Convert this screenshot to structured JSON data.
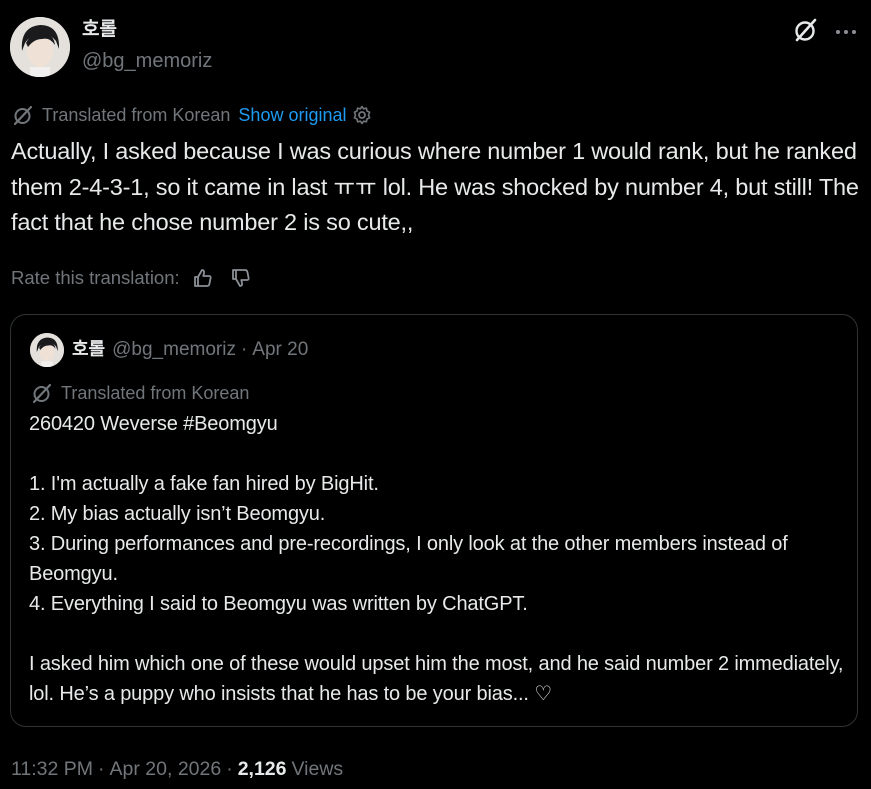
{
  "author": {
    "display_name": "호롤",
    "handle": "@bg_memoriz"
  },
  "header_actions": {
    "grok_icon": "grok-slash-icon",
    "more_icon": "more-dots-icon"
  },
  "translation": {
    "label": "Translated from Korean",
    "show_original": "Show original",
    "icon": "translate-slash-icon",
    "settings_icon": "gear-icon"
  },
  "tweet": {
    "text": "Actually, I asked because I was curious where number 1 would rank, but he ranked them 2-4-3-1, so it came in last ㅠㅠ lol. He was shocked by number 4, but still! The fact that he chose number 2 is so cute,,"
  },
  "rate": {
    "label": "Rate this translation:",
    "up_icon": "thumbs-up-icon",
    "down_icon": "thumbs-down-icon"
  },
  "quote": {
    "display_name": "호롤",
    "handle": "@bg_memoriz",
    "separator": "·",
    "date": "Apr 20",
    "translation_label": "Translated from Korean",
    "lines": [
      "260420 Weverse #Beomgyu",
      "",
      "1. I'm actually a fake fan hired by BigHit.",
      "2. My bias actually isn’t Beomgyu.",
      "3. During performances and pre-recordings, I only look at the other members instead of Beomgyu.",
      "4. Everything I said to Beomgyu was written by ChatGPT.",
      "",
      "I asked him which one of these would upset him the most, and he said number 2 immediately, lol. He’s a puppy who insists that he has to be your bias... ♡"
    ]
  },
  "meta": {
    "time": "11:32 PM",
    "sep1": "·",
    "date": "Apr 20, 2026",
    "sep2": "·",
    "views_count": "2,126",
    "views_label": "Views"
  },
  "colors": {
    "background": "#000000",
    "text": "#e7e9ea",
    "muted": "#71767b",
    "link": "#1d9bf0",
    "border": "#2f3336"
  }
}
